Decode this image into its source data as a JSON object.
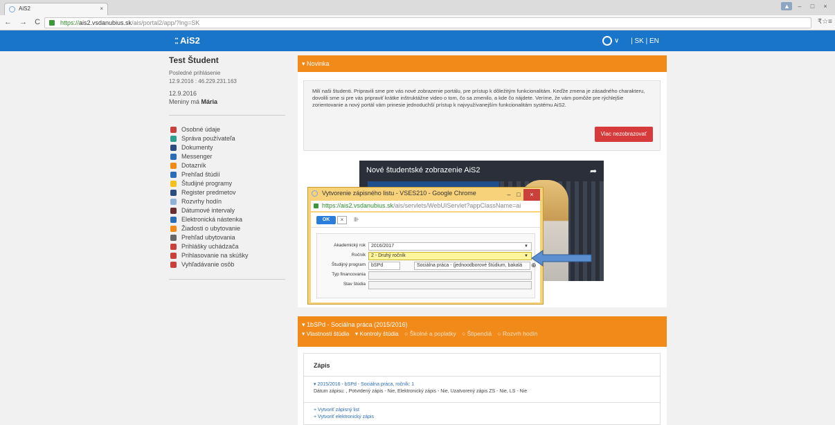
{
  "browser": {
    "tab_title": "AiS2",
    "tab_close": "×",
    "url_scheme": "https://",
    "url_host": "ais2.vsdanubius.sk",
    "url_path": "/ais/portal2/app/?lng=SK",
    "back": "←",
    "forward": "→",
    "reload": "C",
    "home": "⌂",
    "right_icons": "₹☆≡"
  },
  "header": {
    "logo": "AiS2",
    "logo_dots": "⁚⁚",
    "avatar_caret": "∨",
    "langs": "| SK | EN"
  },
  "profile": {
    "name": "Test Študent",
    "last_login_label": "Posledné prihlásenie",
    "last_login_value": "12.9.2016 : 46.229.231.163",
    "date": "12.9.2016",
    "nameday_prefix": "Meniny má ",
    "nameday_name": "Mária"
  },
  "menu": [
    {
      "label": "Osobné údaje",
      "color": "#c9413a"
    },
    {
      "label": "Správa používateľa",
      "color": "#2f9e8f"
    },
    {
      "label": "Dokumenty",
      "color": "#2b4c7e"
    },
    {
      "label": "Messenger",
      "color": "#2b6cb7"
    },
    {
      "label": "Dotazník",
      "color": "#f28a1a"
    },
    {
      "label": "Prehľad štúdií",
      "color": "#2b6cb7"
    },
    {
      "label": "Študijné programy",
      "color": "#f2c11a"
    },
    {
      "label": "Register predmetov",
      "color": "#2b4c7e"
    },
    {
      "label": "Rozvrhy hodín",
      "color": "#8fb3d8"
    },
    {
      "label": "Dátumové intervaly",
      "color": "#6b2e2e"
    },
    {
      "label": "Elektronická nástenka",
      "color": "#2b6cb7"
    },
    {
      "label": "Žiadosti o ubytovanie",
      "color": "#f28a1a"
    },
    {
      "label": "Prehľad ubytovania",
      "color": "#666666"
    },
    {
      "label": "Prihlášky uchádzača",
      "color": "#c9413a"
    },
    {
      "label": "Prihlasovanie na skúšky",
      "color": "#c9413a"
    },
    {
      "label": "Vyhľadávanie osôb",
      "color": "#c9413a"
    }
  ],
  "news": {
    "header": "▾ Novinka",
    "text": "Milí naši študenti. Pripravili sme pre vás nové zobrazenie portálu, pre prístup k dôležitým funkcionalitám. Keďže zmena je zásadného charakteru, dovolili sme si pre vás pripraviť krátke inštruktážne video o tom, čo sa zmenilo, a kde čo nájdete. Veríme, že vám pomôže pre rýchlejšie zorientovanie a nový portál vám prinesie jednoduchší prístup k najvyužívanejším funkcionalitám systému AiS2.",
    "button": "Viac nezobrazovať"
  },
  "video": {
    "title": "Nové študentské zobrazenie AiS2",
    "share": "➦"
  },
  "dialog": {
    "title": "Vytvorenie zápisného listu - VSES210 - Google Chrome",
    "min": "–",
    "max": "□",
    "close": "×",
    "url_host": "https://ais2.vsdanubius.sk",
    "url_path": "/ais/servlets/WebUIServlet?appClassName=ai",
    "ok": "OK",
    "cancel": "×",
    "tool": "⊪",
    "fields": [
      {
        "label": "Akademický rok",
        "value": "2016/2017",
        "arrow": "▼"
      },
      {
        "label": "Ročník",
        "value": "2 - Druhý ročník",
        "arrow": "▼"
      },
      {
        "label": "Študijný program",
        "code": "bSPd",
        "value": "Sociálna práca - (jednoodborové štúdium, bakalá",
        "extra": "⊕"
      },
      {
        "label": "Typ financovania",
        "value": ""
      },
      {
        "label": "Stav štúdia",
        "value": ""
      }
    ]
  },
  "study": {
    "header": "▾ 1bSPd - Sociálna práca (2015/2016)",
    "tabs": [
      "▾ Vlastnosti štúdia",
      "▾ Kontroly štúdia",
      "○ Školné a poplatky",
      "○ Štipendiá",
      "○ Rozvrh hodín"
    ]
  },
  "zapis": {
    "title": "Zápis",
    "line1": "▾ 2015/2016 - bSPd - Sociálna práca, ročník: 1",
    "line2": "Dátum zápisu: , Potvrdený zápis - Nie, Elektronický zápis - Nie, Uzatvorený zápis ZS - Nie, LS - Nie",
    "link1": "+ Vytvoriť zápisný list",
    "link2": "+ Vytvoriť elektronický zápis"
  },
  "colors": {
    "brand_blue": "#1875c9",
    "orange": "#f28a1a",
    "red": "#d63a3a",
    "selected_yellow": "#fff59c"
  }
}
